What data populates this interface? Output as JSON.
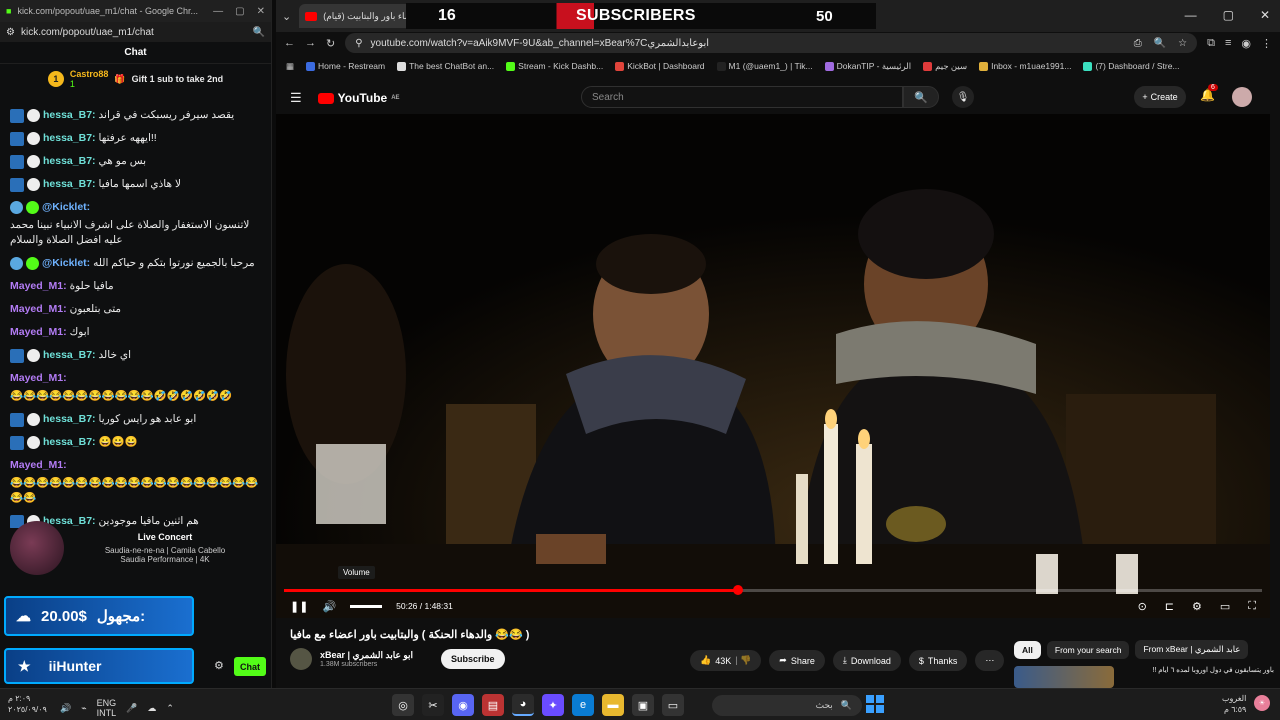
{
  "chat_window": {
    "title": "kick.com/popout/uae_m1/chat - Google Chr...",
    "url": "kick.com/popout/uae_m1/chat",
    "header": "Chat",
    "pinned": {
      "user": "Castro88",
      "count": "1",
      "text": "Gift 1 sub to take 2nd"
    },
    "messages": [
      {
        "user": "hessa_B7:",
        "text": "يقصد سيرفر ريسبكت في قراند",
        "cls": "u-hessa"
      },
      {
        "user": "hessa_B7:",
        "text": "ايههه عرفتها!!",
        "cls": "u-hessa"
      },
      {
        "user": "hessa_B7:",
        "text": "بس مو هي",
        "cls": "u-hessa"
      },
      {
        "user": "hessa_B7:",
        "text": "لا هاذي اسمها مافيا",
        "cls": "u-hessa"
      },
      {
        "user": "@Kicklet:",
        "text": "لاتنسون الاستغفار والصلاة على اشرف الانبياء نبينا محمد عليه افضل الصلاة والسلام",
        "cls": "u-kick"
      },
      {
        "user": "@Kicklet:",
        "text": "مرحبا بالجميع نورتوا بتكم و حياكم الله",
        "cls": "u-kick"
      },
      {
        "user": "Mayed_M1:",
        "text": "مافيا حلوة",
        "cls": "u-mayed"
      },
      {
        "user": "Mayed_M1:",
        "text": "متى بتلعبون",
        "cls": "u-mayed"
      },
      {
        "user": "Mayed_M1:",
        "text": "ابوك",
        "cls": "u-mayed"
      },
      {
        "user": "hessa_B7:",
        "text": "اي خالد",
        "cls": "u-hessa"
      },
      {
        "user": "Mayed_M1:",
        "text": "😂😂😂😂😂😂😂😂😂😂😂🤣🤣🤣🤣🤣🤣",
        "cls": "u-mayed"
      },
      {
        "user": "hessa_B7:",
        "text": "ابو عابد هو رايس كوريا",
        "cls": "u-hessa"
      },
      {
        "user": "hessa_B7:",
        "text": "😀😀😀",
        "cls": "u-hessa"
      },
      {
        "user": "Mayed_M1:",
        "text": "😂😂😂😂😂😂😂😂😂😂😂😂😂😂😂😂😂😂😂😂😂",
        "cls": "u-mayed"
      },
      {
        "user": "hessa_B7:",
        "text": "هم اثنين مافيا موجودين",
        "cls": "u-hessa"
      }
    ],
    "concert": {
      "title": "Live Concert",
      "line1": "Saudia-ne-ne-na | Camila Cabello",
      "line2": "Saudia Performance | 4K"
    },
    "donation": {
      "amount": "20.00$",
      "name": "مجهول:"
    },
    "subscriber": {
      "name": "iiHunter"
    },
    "chat_button": "Chat"
  },
  "browser": {
    "tab_title": "(قيام) فيلم مع اعضاء باور والبتابيت",
    "banner": {
      "count_left": "16",
      "label": "SUBSCRIBERS",
      "count_right": "50"
    },
    "url": "youtube.com/watch?v=aAik9MVF-9U&ab_channel=xBear%7Cابوعابدالشمري",
    "bookmarks": [
      {
        "label": "Home - Restream",
        "color": "#3b6be0"
      },
      {
        "label": "The best ChatBot an...",
        "color": "#ddd"
      },
      {
        "label": "Stream - Kick Dashb...",
        "color": "#53fc18"
      },
      {
        "label": "KickBot | Dashboard",
        "color": "#e0443b"
      },
      {
        "label": "M1 (@uaem1_) | Tik...",
        "color": "#222"
      },
      {
        "label": "DokanTIP - الرئيسية",
        "color": "#a06be0"
      },
      {
        "label": "سين جيم",
        "color": "#e03b3b"
      },
      {
        "label": "Inbox - m1uae1991...",
        "color": "#e0b03b"
      },
      {
        "label": "(7) Dashboard / Stre...",
        "color": "#3be0c0"
      }
    ]
  },
  "youtube": {
    "logo": "YouTube",
    "region": "AE",
    "search_placeholder": "Search",
    "create": "Create",
    "notifications": "6",
    "volume_tip": "Volume",
    "timecode": "50:26 / 1:48:31",
    "progress_pct": 46.4,
    "video_title": "( 😂😂 والدهاء الحنكة ) والبتابيت باور اعضاء مع مافيا",
    "channel_name": "xBear | ابو عابد الشمري",
    "channel_subs": "1.38M subscribers",
    "subscribe": "Subscribe",
    "likes": "43K",
    "share": "Share",
    "download": "Download",
    "thanks": "Thanks",
    "chips": [
      "All",
      "From your search",
      "From xBear | عابد الشمري"
    ],
    "rec_title": "باور يتسابقون في دول اوروبا لمده ٦ ايام !!"
  },
  "taskbar": {
    "time": "٢:٠٩ م",
    "date": "٢٠٢٥/٠٩/٠٩",
    "lang": "ENG",
    "lang2": "INTL",
    "search": "بحث",
    "weather": "الغروب",
    "weather_time": "٦:٥٩ م"
  }
}
